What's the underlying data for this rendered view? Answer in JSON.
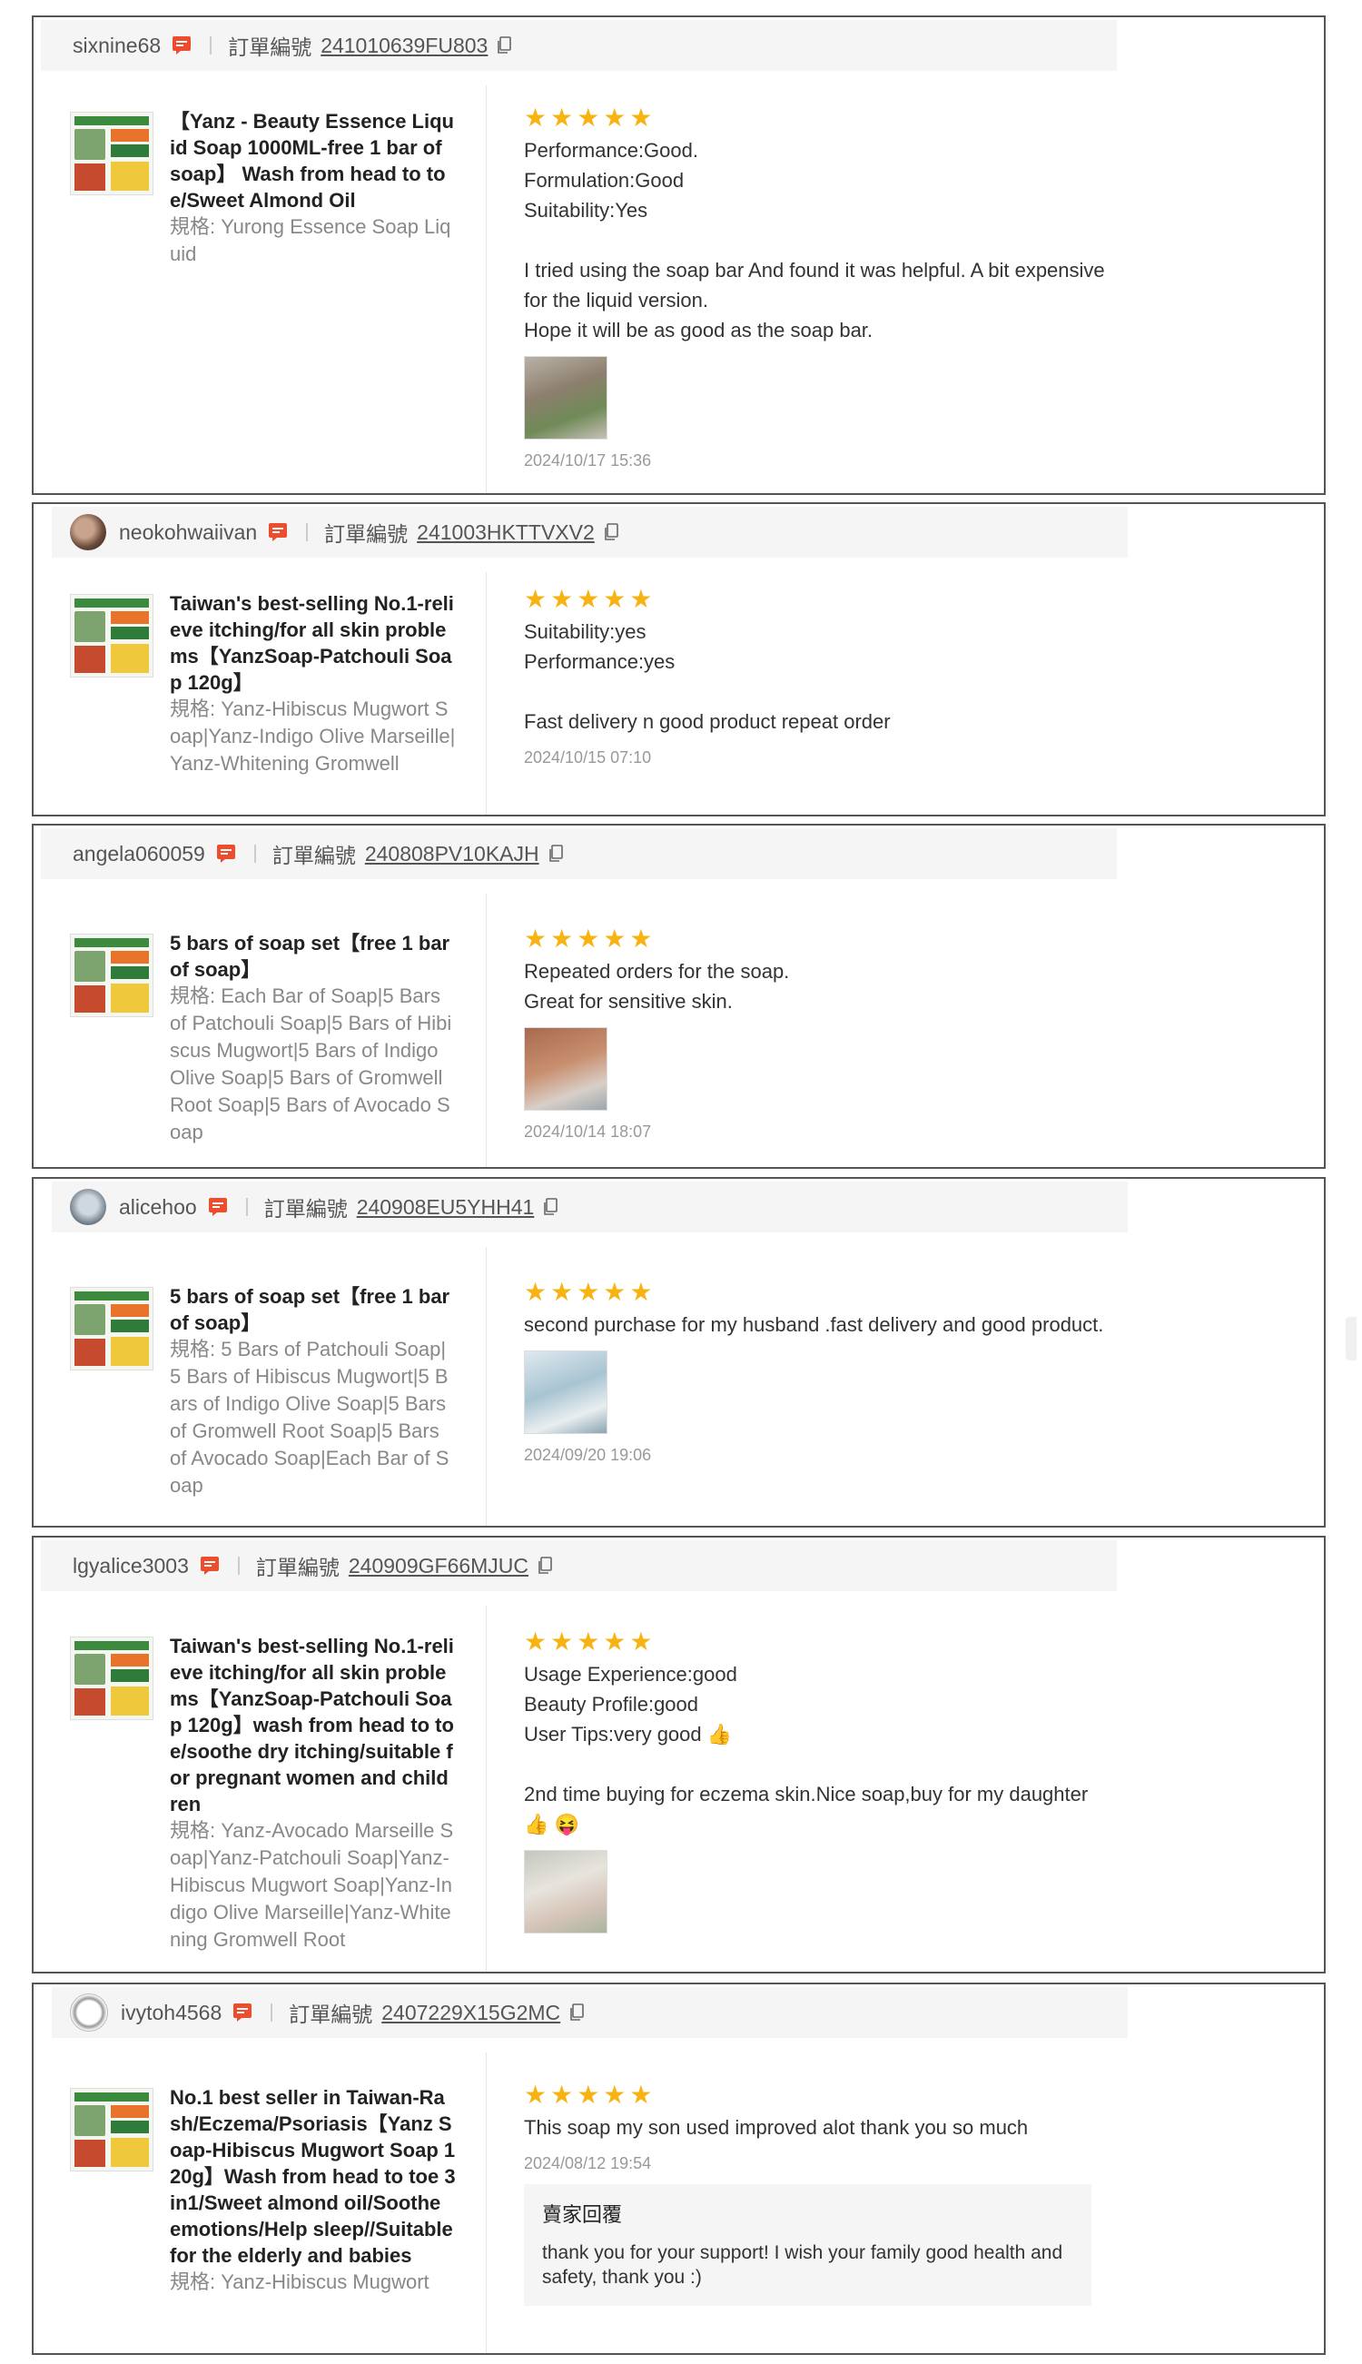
{
  "labels": {
    "order_label": "訂單編號",
    "variant_prefix": "規格: ",
    "seller_reply_title": "賣家回覆"
  },
  "stars": "★★★★★",
  "reviews": [
    {
      "username": "sixnine68",
      "order_no": "241010639FU803",
      "product_name": "【Yanz - Beauty Essence Liquid Soap 1000ML-free 1 bar of soap】 Wash from head to toe/Sweet Almond Oil",
      "variant": "規格: Yurong Essence Soap Liquid",
      "text_lines": [
        "Performance:Good.",
        "Formulation:Good",
        "Suitability:Yes",
        "",
        "I tried using the soap bar And found it was helpful. A bit expensive for the liquid version.",
        "Hope it will be as good as the soap bar."
      ],
      "date": "2024/10/17 15:36"
    },
    {
      "username": "neokohwaiivan",
      "order_no": "241003HKTTVXV2",
      "product_name": "Taiwan's best-selling No.1-relieve itching/for all skin problems【YanzSoap-Patchouli Soap 120g】",
      "variant": "規格: Yanz-Hibiscus Mugwort Soap|Yanz-Indigo Olive Marseille|Yanz-Whitening Gromwell",
      "text_lines": [
        "Suitability:yes",
        "Performance:yes",
        "",
        "Fast delivery n good product repeat order"
      ],
      "date": "2024/10/15 07:10"
    },
    {
      "username": "angela060059",
      "order_no": "240808PV10KAJH",
      "product_name": "5 bars of soap set【free 1 bar of soap】",
      "variant": "規格: Each Bar of Soap|5 Bars of Patchouli Soap|5 Bars of Hibiscus Mugwort|5 Bars of Indigo Olive Soap|5 Bars of Gromwell Root Soap|5 Bars of Avocado Soap",
      "text_lines": [
        "Repeated orders for the soap.",
        "Great for sensitive skin."
      ],
      "date": "2024/10/14 18:07"
    },
    {
      "username": "alicehoo",
      "order_no": "240908EU5YHH41",
      "product_name": "5 bars of soap set【free 1 bar of soap】",
      "variant": "規格: 5 Bars of Patchouli Soap|5 Bars of Hibiscus Mugwort|5 Bars of Indigo Olive Soap|5 Bars of Gromwell Root Soap|5 Bars of Avocado Soap|Each Bar of Soap",
      "text_lines": [
        "second purchase for my husband .fast delivery and good product."
      ],
      "date": "2024/09/20 19:06"
    },
    {
      "username": "lgyalice3003",
      "order_no": "240909GF66MJUC",
      "product_name": "Taiwan's best-selling No.1-relieve itching/for all skin problems【YanzSoap-Patchouli Soap 120g】wash from head to toe/soothe dry itching/suitable for pregnant women and children",
      "variant": "規格: Yanz-Avocado Marseille Soap|Yanz-Patchouli Soap|Yanz-Hibiscus Mugwort Soap|Yanz-Indigo Olive Marseille|Yanz-Whitening Gromwell Root",
      "text_lines": [
        "Usage Experience:good",
        "Beauty Profile:good",
        "User Tips:very good 👍",
        "",
        "2nd time buying for eczema skin.Nice soap,buy for my daughter 👍 😝"
      ],
      "date": ""
    },
    {
      "username": "ivytoh4568",
      "order_no": "2407229X15G2MC",
      "product_name": "No.1 best seller in Taiwan-Rash/Eczema/Psoriasis【Yanz Soap-Hibiscus Mugwort Soap 120g】Wash from head to toe 3in1/Sweet almond oil/Soothe emotions/Help sleep//Suitable for the elderly and babies",
      "variant": "規格: Yanz-Hibiscus Mugwort",
      "text_lines": [
        "This soap my son used improved alot thank you so much"
      ],
      "date": "2024/08/12 19:54",
      "seller_reply": "thank you for your support! I wish your family good health and safety, thank you :)"
    }
  ]
}
